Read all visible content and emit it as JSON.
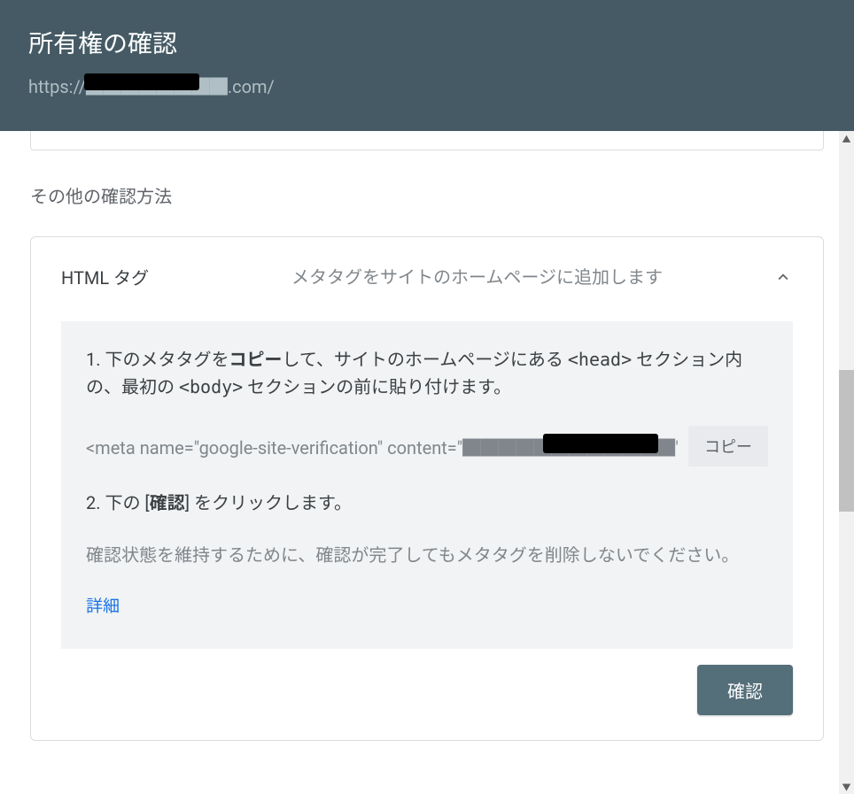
{
  "header": {
    "title": "所有権の確認",
    "url_prefix": "https://",
    "url_hidden": "████████",
    "url_suffix": ".com/"
  },
  "section_label": "その他の確認方法",
  "method": {
    "name": "HTML タグ",
    "desc": "メタタグをサイトのホームページに追加します"
  },
  "panel": {
    "step1_prefix": "1. 下のメタタグを",
    "step1_bold": "コピー",
    "step1_mid": "して、サイトのホームページにある ",
    "step1_head": "<head>",
    "step1_mid2": " セクション内の、最初の ",
    "step1_body": "<body>",
    "step1_suffix": " セクションの前に貼り付けます。",
    "code": "<meta name=\"google-site-verification\" content=\"████████████\"",
    "copy_label": "コピー",
    "step2_prefix": "2. 下の [",
    "step2_bold": "確認",
    "step2_suffix": "] をクリックします。",
    "note": "確認状態を維持するために、確認が完了してもメタタグを削除しないでください。",
    "details": "詳細"
  },
  "confirm_label": "確認"
}
